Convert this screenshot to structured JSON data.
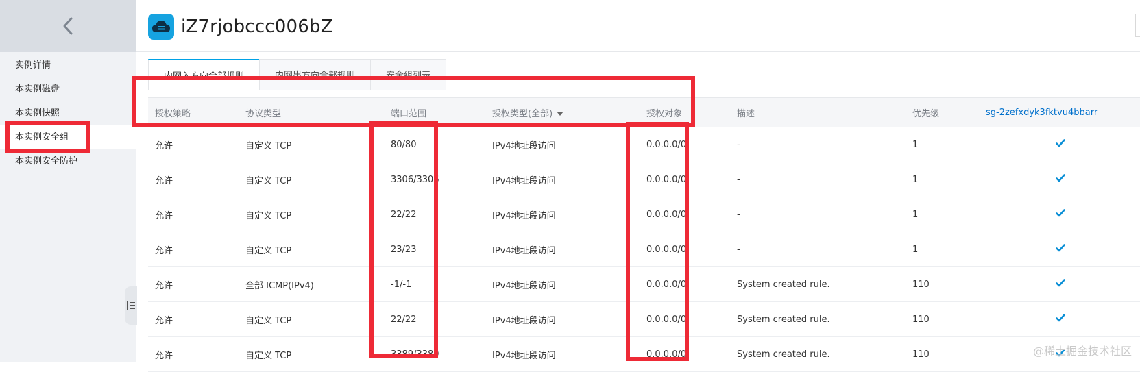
{
  "sidebar": {
    "back_icon": "chevron-left-icon",
    "items": [
      {
        "label": "实例详情",
        "active": false
      },
      {
        "label": "本实例磁盘",
        "active": false
      },
      {
        "label": "本实例快照",
        "active": false
      },
      {
        "label": "本实例安全组",
        "active": true
      },
      {
        "label": "本实例安全防护",
        "active": false
      }
    ],
    "collapse_icon": "collapse-panel-icon"
  },
  "header": {
    "icon": "cloud-server-icon",
    "title": "iZ7rjobccc006bZ"
  },
  "tabs": [
    {
      "label": "内网入方向全部规则",
      "active": true
    },
    {
      "label": "内网出方向全部规则",
      "active": false
    },
    {
      "label": "安全组列表",
      "active": false
    }
  ],
  "table": {
    "columns": [
      "授权策略",
      "协议类型",
      "端口范围",
      "授权类型(全部)",
      "授权对象",
      "描述",
      "优先级",
      "sg-2zefxdyk3fktvu4bbarr"
    ],
    "rows": [
      {
        "policy": "允许",
        "protocol": "自定义 TCP",
        "port": "80/80",
        "auth_type": "IPv4地址段访问",
        "target": "0.0.0.0/0",
        "desc": "-",
        "priority": "1"
      },
      {
        "policy": "允许",
        "protocol": "自定义 TCP",
        "port": "3306/3306",
        "auth_type": "IPv4地址段访问",
        "target": "0.0.0.0/0",
        "desc": "-",
        "priority": "1"
      },
      {
        "policy": "允许",
        "protocol": "自定义 TCP",
        "port": "22/22",
        "auth_type": "IPv4地址段访问",
        "target": "0.0.0.0/0",
        "desc": "-",
        "priority": "1"
      },
      {
        "policy": "允许",
        "protocol": "自定义 TCP",
        "port": "23/23",
        "auth_type": "IPv4地址段访问",
        "target": "0.0.0.0/0",
        "desc": "-",
        "priority": "1"
      },
      {
        "policy": "允许",
        "protocol": "全部 ICMP(IPv4)",
        "port": "-1/-1",
        "auth_type": "IPv4地址段访问",
        "target": "0.0.0.0/0",
        "desc": "System created rule.",
        "priority": "110"
      },
      {
        "policy": "允许",
        "protocol": "自定义 TCP",
        "port": "22/22",
        "auth_type": "IPv4地址段访问",
        "target": "0.0.0.0/0",
        "desc": "System created rule.",
        "priority": "110"
      },
      {
        "policy": "允许",
        "protocol": "自定义 TCP",
        "port": "3389/3389",
        "auth_type": "IPv4地址段访问",
        "target": "0.0.0.0/0",
        "desc": "System created rule.",
        "priority": "110"
      }
    ]
  },
  "check_icon": "checkmark-icon",
  "colors": {
    "accent": "#00a2e6",
    "highlight": "#ee2a36",
    "check": "#0a8fd6",
    "link": "#0070cc"
  },
  "watermark": "@稀土掘金技术社区"
}
